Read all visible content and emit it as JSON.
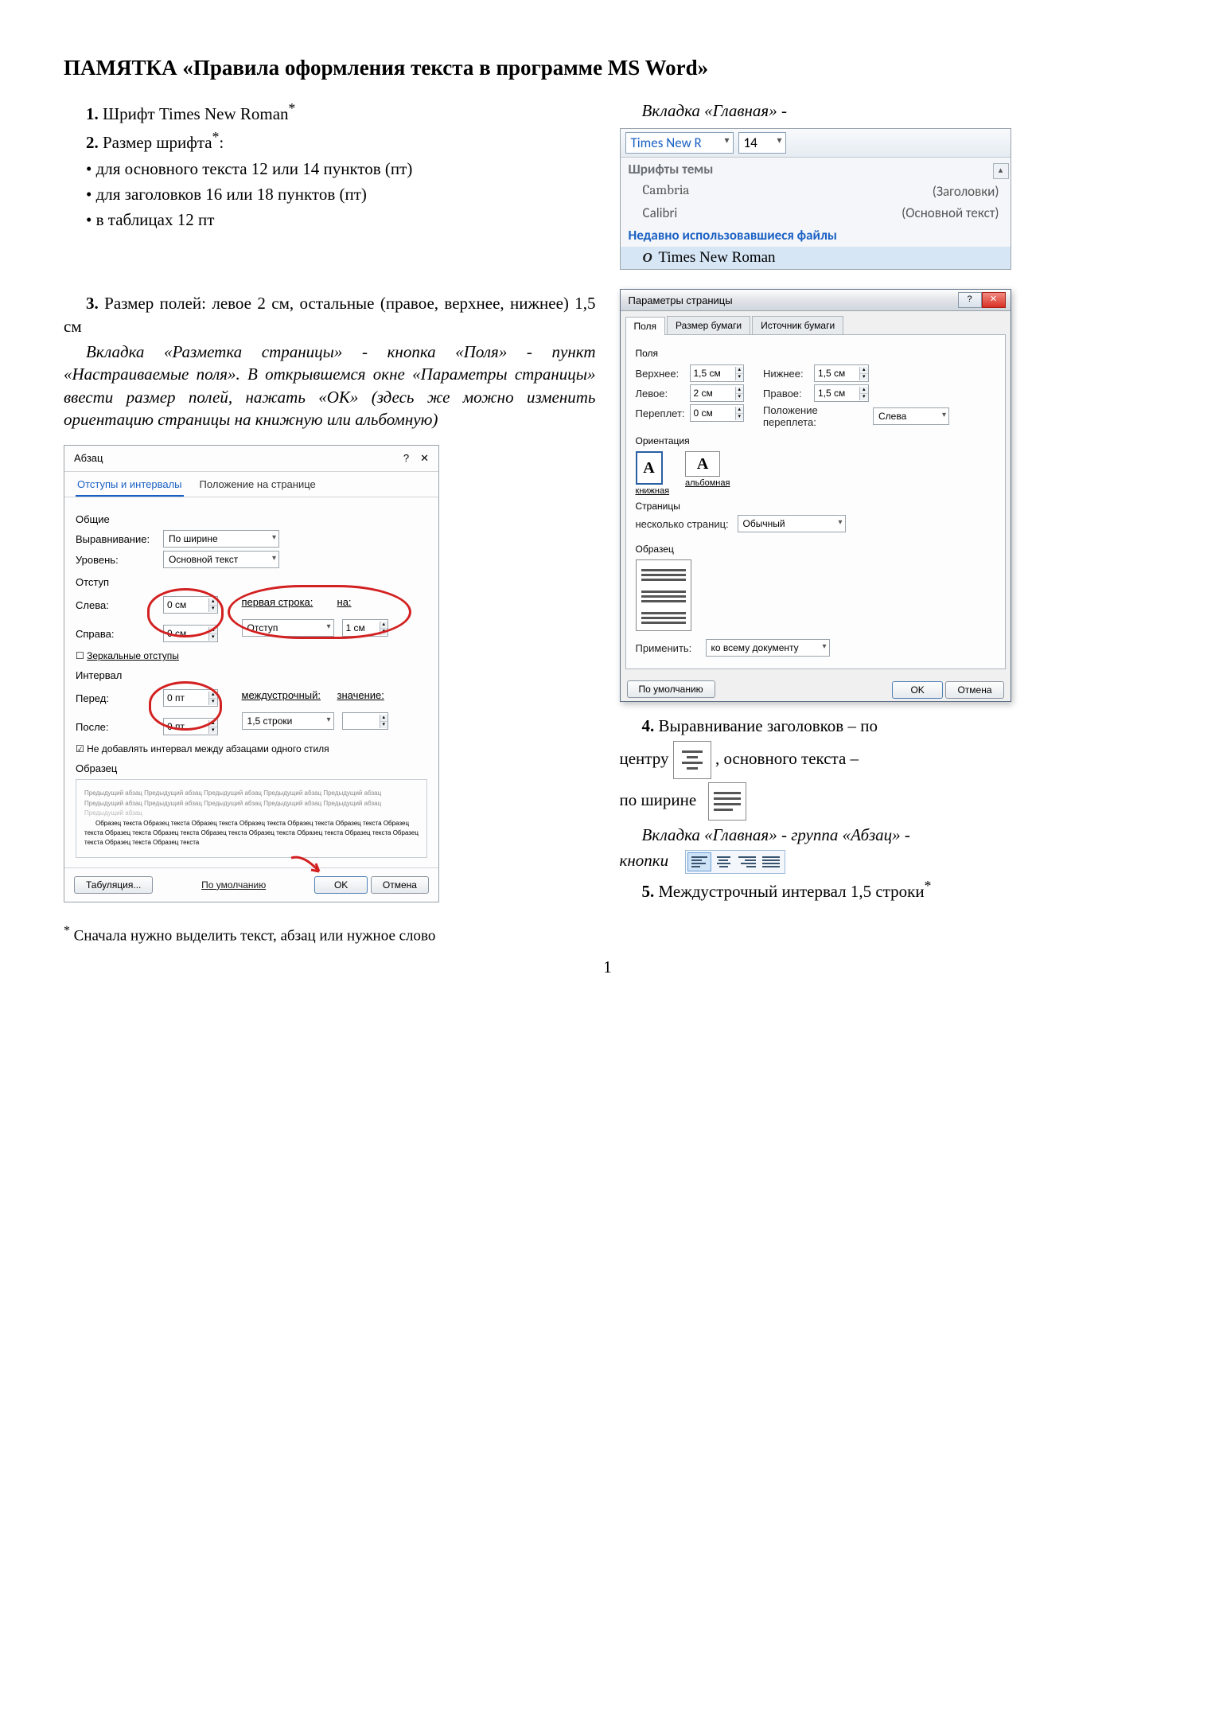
{
  "title": "ПАМЯТКА «Правила оформления текста в программе MS Word»",
  "rules": {
    "r1": "Шрифт Times New Roman",
    "r2": "Размер шрифта",
    "r2a": "для основного текста 12 или 14 пунктов (пт)",
    "r2b": "для заголовков 16 или 18 пунктов (пт)",
    "r2c": "в таблицах 12 пт",
    "r3": "Размер полей: левое 2 см, остальные (правое, верхнее, нижнее) 1,5 см",
    "r3_hint": "Вкладка «Разметка страницы» - кнопка «Поля» - пункт «Настраиваемые поля». В открывшемся окне «Параметры страницы» ввести размер полей, нажать «ОК» (здесь же можно изменить ориентацию страницы на книжную или альбомную)",
    "r4a": "Выравнивание заголовков – по",
    "r4_center": "центру",
    "r4b": ", основного текста –",
    "r4_justify": "по ширине",
    "r4_hint1": "Вкладка «Главная» - группа «Абзац» -",
    "r4_hint2": "кнопки",
    "r5": "Междустрочный интервал 1,5 строки",
    "tab_hint": "Вкладка «Главная» -"
  },
  "font_panel": {
    "font_combo": "Times New R",
    "size_combo": "14",
    "section1": "Шрифты темы",
    "row1_name": "Cambria",
    "row1_role": "(Заголовки)",
    "row2_name": "Calibri",
    "row2_role": "(Основной текст)",
    "section2": "Недавно использовавшиеся файлы",
    "recent": "Times New Roman"
  },
  "page_setup": {
    "title": "Параметры страницы",
    "tabs": {
      "t1": "Поля",
      "t2": "Размер бумаги",
      "t3": "Источник бумаги"
    },
    "grp_margins": "Поля",
    "top_l": "Верхнее:",
    "top_v": "1,5 см",
    "bottom_l": "Нижнее:",
    "bottom_v": "1,5 см",
    "left_l": "Левое:",
    "left_v": "2 см",
    "right_l": "Правое:",
    "right_v": "1,5 см",
    "gutter_l": "Переплет:",
    "gutter_v": "0 см",
    "gutterpos_l": "Положение переплета:",
    "gutterpos_v": "Слева",
    "grp_orient": "Ориентация",
    "orient_portrait": "книжная",
    "orient_landscape": "альбомная",
    "grp_pages": "Страницы",
    "multi_l": "несколько страниц:",
    "multi_v": "Обычный",
    "grp_preview": "Образец",
    "apply_l": "Применить:",
    "apply_v": "ко всему документу",
    "default_btn": "По умолчанию",
    "ok": "OK",
    "cancel": "Отмена"
  },
  "para": {
    "title": "Абзац",
    "tab1": "Отступы и интервалы",
    "tab2": "Положение на странице",
    "grp_general": "Общие",
    "align_l": "Выравнивание:",
    "align_v": "По ширине",
    "level_l": "Уровень:",
    "level_v": "Основной текст",
    "grp_indent": "Отступ",
    "left_l": "Слева:",
    "left_v": "0 см",
    "right_l": "Справа:",
    "right_v": "0 см",
    "first_l": "первая строка:",
    "first_v": "Отступ",
    "by_l": "на:",
    "by_v": "1 см",
    "mirror": "Зеркальные отступы",
    "grp_spacing": "Интервал",
    "before_l": "Перед:",
    "before_v": "0 пт",
    "after_l": "После:",
    "after_v": "0 пт",
    "line_l": "междустрочный:",
    "line_v": "1,5 строки",
    "at_l": "значение:",
    "at_v": "",
    "nospace": "Не добавлять интервал между абзацами одного стиля",
    "grp_preview": "Образец",
    "tabs_btn": "Табуляция...",
    "default_btn": "По умолчанию",
    "ok": "OK",
    "cancel": "Отмена"
  },
  "footnote": "Сначала нужно выделить текст, абзац или нужное слово",
  "page_num": "1"
}
